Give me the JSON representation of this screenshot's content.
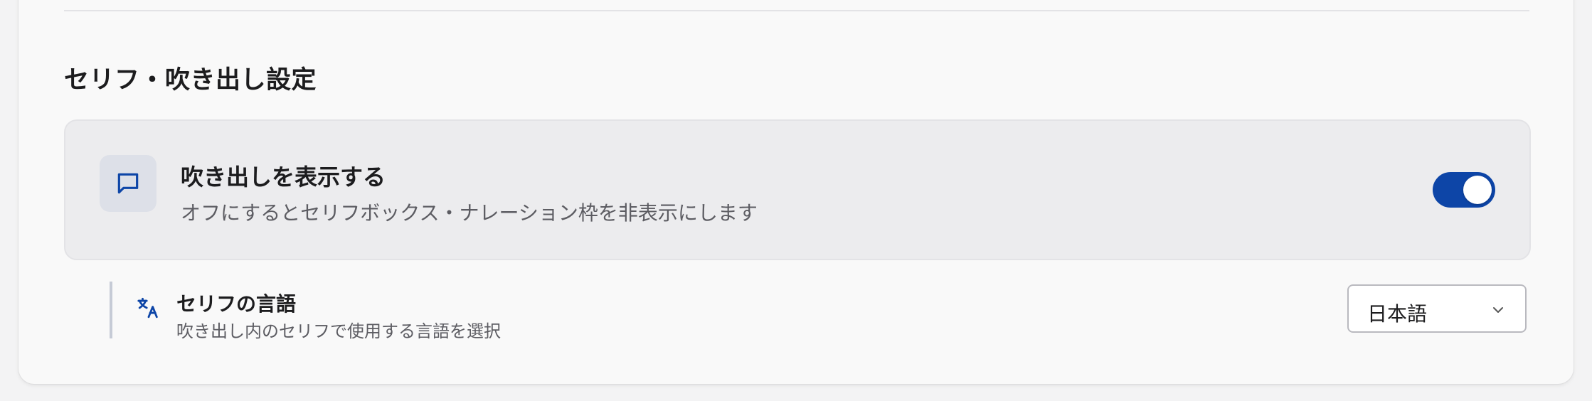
{
  "section": {
    "title": "セリフ・吹き出し設定"
  },
  "balloon_toggle": {
    "icon": "speech-bubble-icon",
    "title": "吹き出しを表示する",
    "description": "オフにするとセリフボックス・ナレーション枠を非表示にします",
    "enabled": true,
    "accent_color": "#0d45a7"
  },
  "dialogue_language": {
    "icon": "translate-icon",
    "title": "セリフの言語",
    "description": "吹き出し内のセリフで使用する言語を選択",
    "selected": "日本語"
  }
}
